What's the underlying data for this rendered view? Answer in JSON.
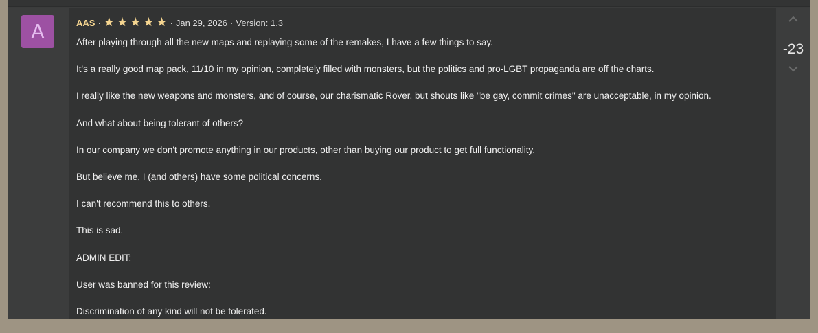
{
  "review": {
    "avatar_letter": "A",
    "author": "AAS",
    "separator": "·",
    "rating": 5,
    "date": "Jan 29, 2026",
    "version": "Version: 1.3",
    "paragraphs": [
      "After playing through all the new maps and replaying some of the remakes, I have a few things to say.",
      "It's a really good map pack, 11/10 in my opinion, completely filled with monsters, but the politics and pro-LGBT propaganda are off the charts.",
      "I really like the new weapons and monsters, and of course, our charismatic Rover, but shouts like \"be gay, commit crimes\" are unacceptable, in my opinion.",
      "And what about being tolerant of others?",
      "In our company we don't promote anything in our products, other than buying our product to get full functionality.",
      "But believe me, I (and others) have some political concerns.",
      "I can't recommend this to others.",
      "This is sad.",
      "ADMIN EDIT:",
      "User was banned for this review:",
      "Discrimination of any kind will not be tolerated."
    ]
  },
  "votes": {
    "score": "-23",
    "up_icon": "chevron-up-icon",
    "down_icon": "chevron-down-icon"
  },
  "colors": {
    "avatar_bg": "#9d51a3",
    "author": "#f5d590",
    "star": "#f5d590",
    "panel": "#323333",
    "side": "#3c3d3d"
  }
}
